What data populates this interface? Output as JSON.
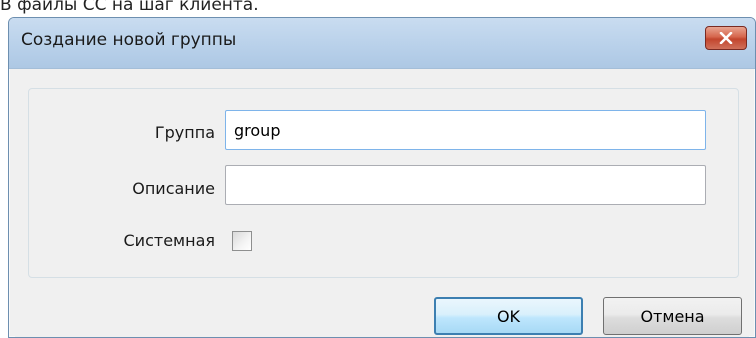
{
  "background": {
    "partial_text": "В файлы СС на шаг клиента."
  },
  "dialog": {
    "title": "Создание новой группы",
    "fields": {
      "group_label": "Группа",
      "group_value": "group",
      "description_label": "Описание",
      "description_value": "",
      "system_label": "Системная",
      "system_checked": false
    },
    "buttons": {
      "ok_label": "OK",
      "cancel_label": "Отмена"
    }
  },
  "colors": {
    "title_bar": "#b9d1ea",
    "close_button": "#c2452d",
    "dialog_background": "#f0f0f0",
    "ok_border": "#3c7fb1"
  },
  "icons": {
    "close": "close-icon"
  }
}
